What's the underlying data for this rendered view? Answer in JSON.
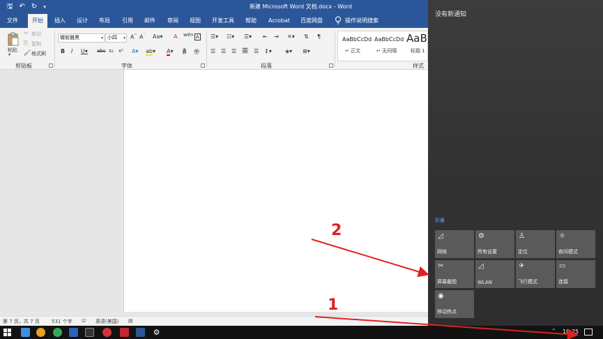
{
  "word": {
    "title": "新建 Microsoft Word 文档.docx  -  Word",
    "tabs": [
      "文件",
      "开始",
      "插入",
      "设计",
      "布局",
      "引用",
      "邮件",
      "审阅",
      "视图",
      "开发工具",
      "帮助",
      "Acrobat",
      "百度网盘",
      "操作说明搜索"
    ],
    "active_tab": "开始",
    "clipboard": {
      "paste": "粘贴",
      "cut": "剪切",
      "copy": "复制",
      "format_painter": "格式刷",
      "label": "剪贴板"
    },
    "font": {
      "name": "微软雅黑",
      "size": "小四",
      "label": "字体"
    },
    "paragraph": {
      "label": "段落"
    },
    "styles": {
      "items": [
        {
          "preview": "AaBbCcDd",
          "name": "↵ 正文"
        },
        {
          "preview": "AaBbCcDd",
          "name": "↵ 无间隔"
        },
        {
          "preview": "AaB",
          "name": "标题 1"
        }
      ],
      "label": "样式"
    },
    "status": {
      "page": "第 7 页，共 7 页",
      "words": "531 个字",
      "language": "英语(美国)"
    }
  },
  "action_center": {
    "no_notifications": "没有新通知",
    "collapse": "折叠",
    "tiles": [
      {
        "icon": "network-icon",
        "glyph": "◿",
        "label": "网络"
      },
      {
        "icon": "settings-icon",
        "glyph": "⚙",
        "label": "所有设置"
      },
      {
        "icon": "location-icon",
        "glyph": "♙",
        "label": "定位"
      },
      {
        "icon": "night-mode-icon",
        "glyph": "☼",
        "label": "夜间模式"
      },
      {
        "icon": "screen-snip-icon",
        "glyph": "✂",
        "label": "屏幕截图"
      },
      {
        "icon": "wlan-icon",
        "glyph": "◿",
        "label": "WLAN"
      },
      {
        "icon": "airplane-icon",
        "glyph": "✈",
        "label": "飞行模式"
      },
      {
        "icon": "connect-icon",
        "glyph": "▭",
        "label": "连接"
      },
      {
        "icon": "hotspot-icon",
        "glyph": "◉",
        "label": "移动热点"
      }
    ]
  },
  "taskbar": {
    "time": "10:25"
  },
  "annotations": {
    "step1": "1",
    "step2": "2",
    "color": "#e02020"
  },
  "colors": {
    "word_blue": "#2b579a",
    "tile_gray": "#5a5a5a",
    "accent_link": "#5aa0e8"
  }
}
